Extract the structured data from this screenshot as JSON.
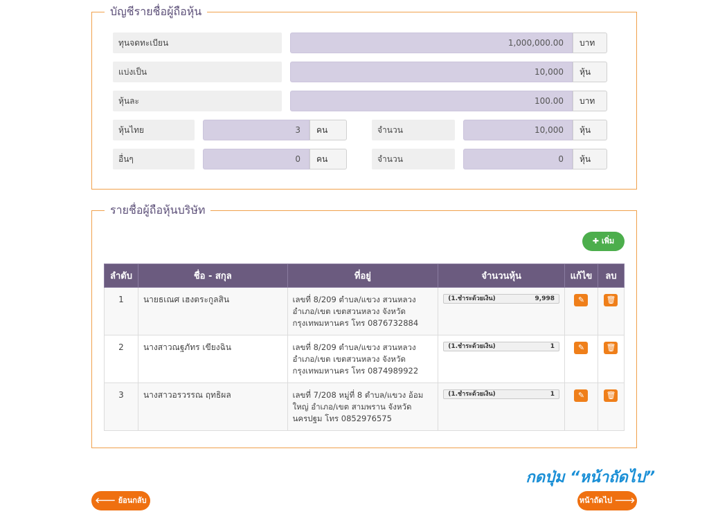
{
  "shareholder_list": {
    "title": "บัญชีรายชื่อผู้ถือหุ้น",
    "registered_capital": {
      "label": "ทุนจดทะเบียน",
      "value": "1,000,000.00",
      "unit": "บาท"
    },
    "divided_into": {
      "label": "แบ่งเป็น",
      "value": "10,000",
      "unit": "หุ้น"
    },
    "per_share": {
      "label": "หุ้นละ",
      "value": "100.00",
      "unit": "บาท"
    },
    "thai_holders": {
      "label": "หุ้นไทย",
      "value": "3",
      "unit": "คน",
      "amount_label": "จำนวน",
      "amount": "10,000",
      "amount_unit": "หุ้น"
    },
    "other_holders": {
      "label": "อื่นๆ",
      "value": "0",
      "unit": "คน",
      "amount_label": "จำนวน",
      "amount": "0",
      "amount_unit": "หุ้น"
    }
  },
  "company_holders": {
    "title": "รายชื่อผู้ถือหุ้นบริษัท",
    "add_label": "เพิ่ม",
    "add_icon": "plus-icon",
    "columns": [
      "ลำดับ",
      "ชื่อ - สกุล",
      "ที่อยู่",
      "จำนวนหุ้น",
      "แก้ไข",
      "ลบ"
    ],
    "rows": [
      {
        "no": "1",
        "name": "นายธเณศ เฮงตระกูลสิน",
        "address": "เลขที่ 8/209 ตำบล/แขวง สวนหลวง อำเภอ/เขต เขตสวนหลวง จังหวัด กรุงเทพมหานคร โทร 0876732884",
        "share_type": "(1.ชำระด้วยเงิน)",
        "shares": "9,998"
      },
      {
        "no": "2",
        "name": "นางสาวณฐภัทร เขียงฉิน",
        "address": "เลขที่ 8/209 ตำบล/แขวง สวนหลวง อำเภอ/เขต เขตสวนหลวง จังหวัด กรุงเทพมหานคร โทร 0874989922",
        "share_type": "(1.ชำระด้วยเงิน)",
        "shares": "1"
      },
      {
        "no": "3",
        "name": "นางสาวอรวรรณ ฤทธิผล",
        "address": "เลขที่ 7/208 หมู่ที่ 8 ตำบล/แขวง อ้อมใหญ่ อำเภอ/เขต สามพราน จังหวัด นครปฐม โทร 0852976575",
        "share_type": "(1.ชำระด้วยเงิน)",
        "shares": "1"
      }
    ]
  },
  "hint": "กดปุ่ม “หน้าถัดไป”",
  "nav": {
    "back_label": "ย้อนกลับ",
    "next_label": "หน้าถัดไป"
  },
  "colors": {
    "accent": "#ef7010",
    "header": "#6b5b7f",
    "field": "#d5cfe3",
    "border": "#f0a04b",
    "hint": "#1a8fd6",
    "add": "#4cae4c"
  }
}
